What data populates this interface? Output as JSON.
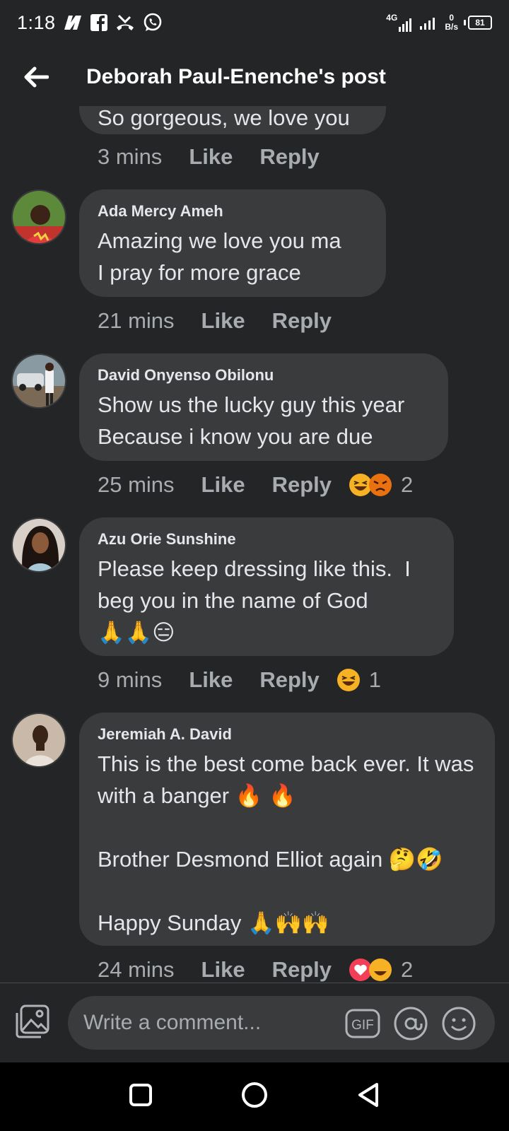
{
  "status_bar": {
    "time": "1:18",
    "network": "4G",
    "net_speed_value": "0",
    "net_speed_unit": "B/s",
    "battery": "81"
  },
  "header": {
    "title": "Deborah Paul-Enenche's post"
  },
  "partial_top_comment": {
    "text": "So gorgeous, we love you",
    "time": "3 mins",
    "like_label": "Like",
    "reply_label": "Reply"
  },
  "comments": [
    {
      "author": "Ada Mercy Ameh",
      "text": "Amazing we love you ma\nI pray for more grace",
      "time": "21 mins",
      "like_label": "Like",
      "reply_label": "Reply",
      "reactions": [],
      "reaction_count": ""
    },
    {
      "author": "David Onyenso Obilonu",
      "text": "Show us the lucky guy this year\nBecause i know you are due",
      "time": "25 mins",
      "like_label": "Like",
      "reply_label": "Reply",
      "reactions": [
        "haha",
        "angry"
      ],
      "reaction_count": "2"
    },
    {
      "author": "Azu Orie Sunshine",
      "text": "Please keep dressing like this.  I beg you in the name of God\n🙏🙏😑",
      "time": "9 mins",
      "like_label": "Like",
      "reply_label": "Reply",
      "reactions": [
        "haha"
      ],
      "reaction_count": "1"
    },
    {
      "author": "Jeremiah A. David",
      "text": "This is the best come back ever. It was with a banger 🔥 🔥\n\nBrother Desmond Elliot again 🤔🤣\n\nHappy Sunday 🙏🙌🙌",
      "time": "24 mins",
      "like_label": "Like",
      "reply_label": "Reply",
      "reactions": [
        "love",
        "haha"
      ],
      "reaction_count": "2"
    }
  ],
  "composer": {
    "placeholder": "Write a comment...",
    "gif_label": "GIF"
  },
  "colors": {
    "background": "#242526",
    "bubble": "#3a3b3c",
    "text": "#e4e6eb",
    "meta": "#a8abaf",
    "haha": "#f7b125",
    "angry": "#e9710f",
    "love": "#f33e58"
  },
  "icons": [
    "back-arrow-icon",
    "photo-icon",
    "gif-icon",
    "mention-icon",
    "emoji-icon",
    "nav-square-icon",
    "nav-circle-icon",
    "nav-back-triangle-icon"
  ]
}
